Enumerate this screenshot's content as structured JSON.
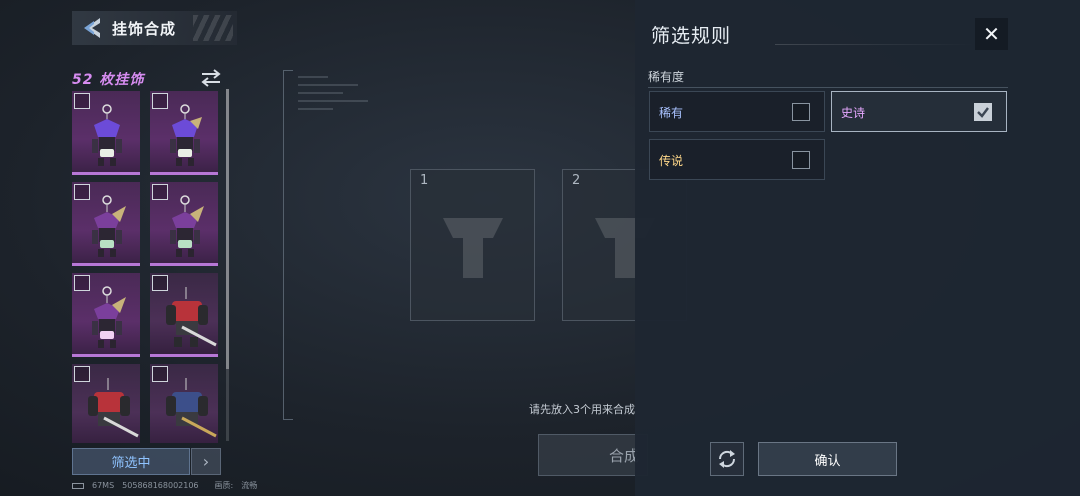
{
  "header": {
    "title": "挂饰合成"
  },
  "collection": {
    "count_label": "52 枚挂饰"
  },
  "slots": [
    {
      "number": "1"
    },
    {
      "number": "2"
    }
  ],
  "hint": "请先放入3个用来合成",
  "compose_label": "合成",
  "filter_button_label": "筛选中",
  "footer": {
    "ping": "67MS",
    "uid": "505868168002106",
    "quality_label": "画质:",
    "quality_value": "流畅"
  },
  "filter_panel": {
    "title": "筛选规则",
    "section_label": "稀有度",
    "options": [
      {
        "label": "稀有",
        "checked": false,
        "color": "#a9c2ff"
      },
      {
        "label": "史诗",
        "checked": true,
        "color": "#e6a8ff"
      },
      {
        "label": "传说",
        "checked": false,
        "color": "#ffd88a"
      }
    ],
    "confirm_label": "确认"
  },
  "colors": {
    "epic_accent": "#b777d6",
    "panel_bg": "#1e2632"
  }
}
